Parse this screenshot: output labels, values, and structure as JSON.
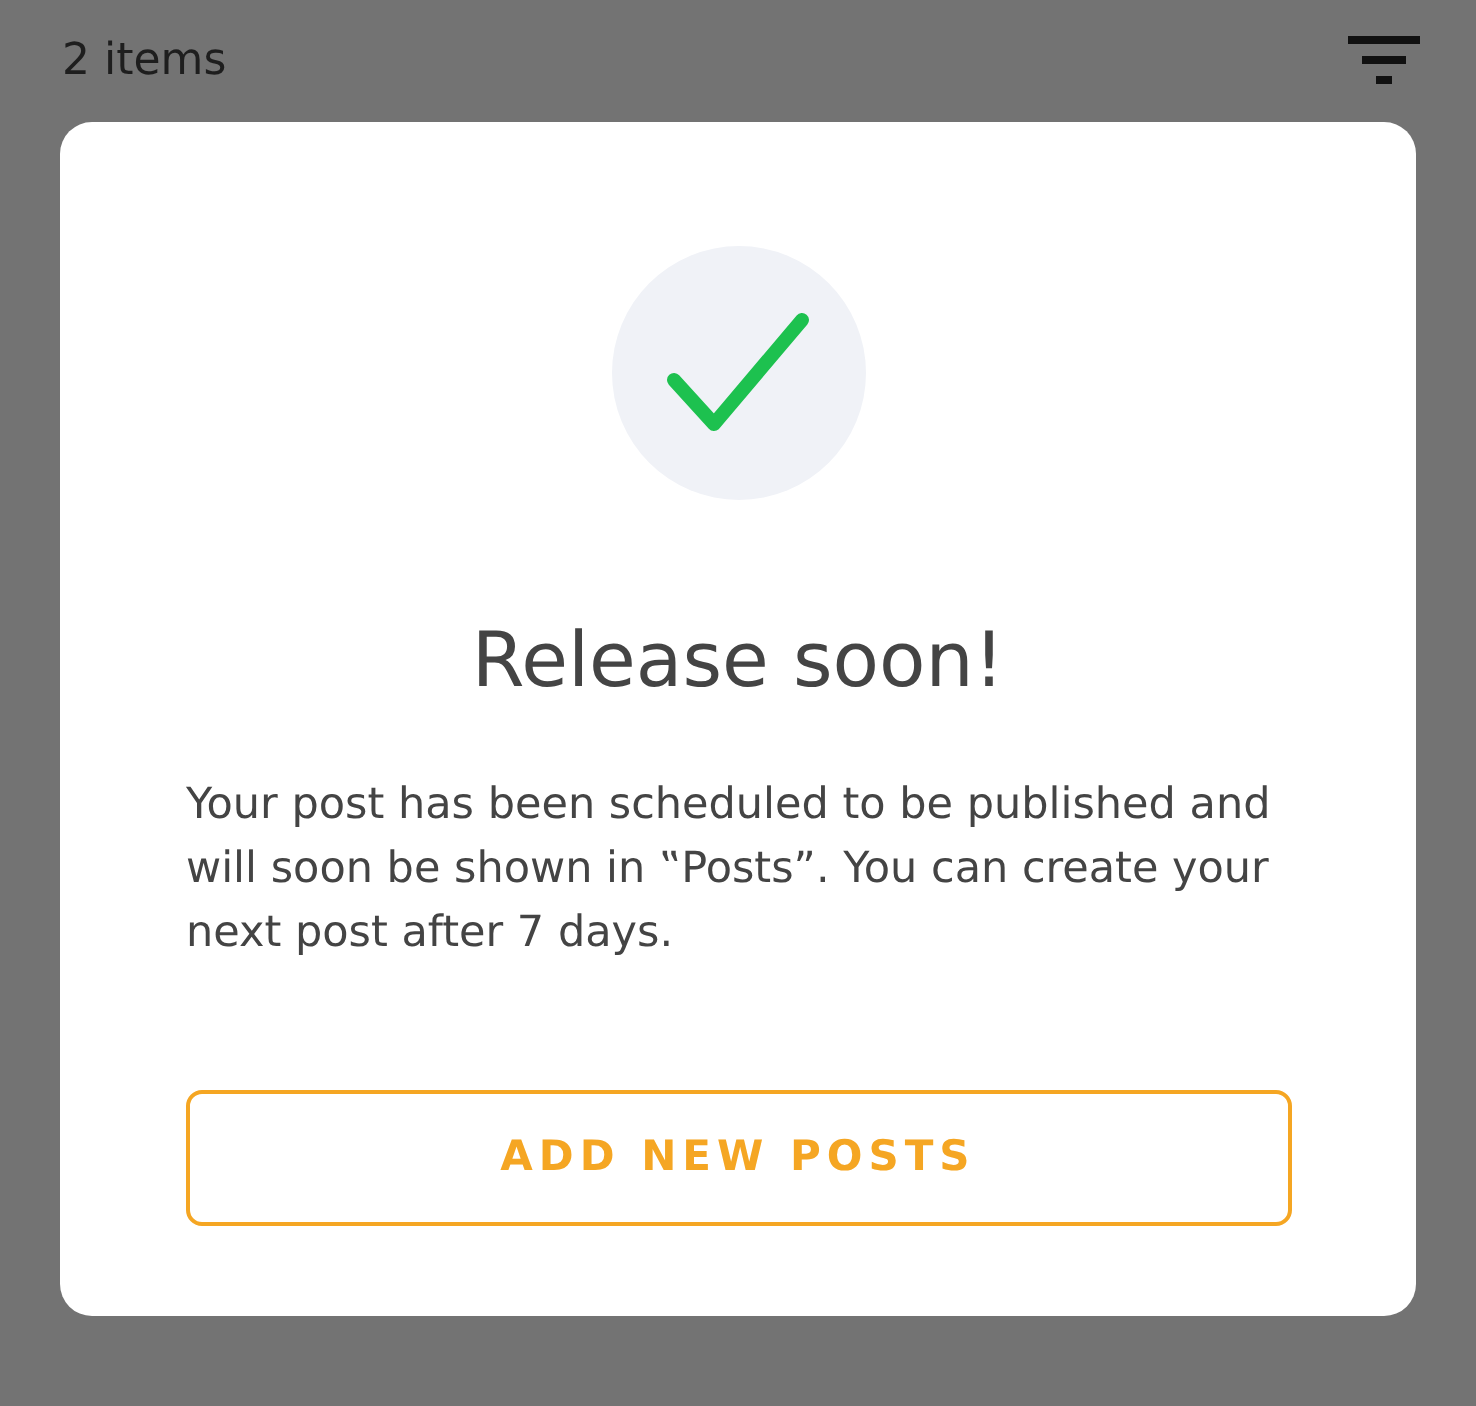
{
  "header": {
    "count": "2 items"
  },
  "dialog": {
    "title": "Release soon!",
    "message": "Your post has been scheduled to be published and will soon be shown in ‟Posts”. You can create your next post after 7 days.",
    "button": "ADD NEW POSTS"
  }
}
